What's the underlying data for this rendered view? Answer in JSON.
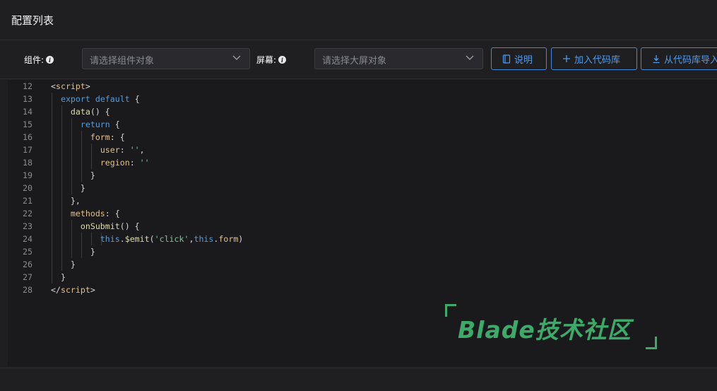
{
  "header": {
    "title": "配置列表"
  },
  "toolbar": {
    "component_label": "组件:",
    "component_placeholder": "请选择组件对象",
    "screen_label": "屏幕:",
    "screen_placeholder": "请选择大屏对象",
    "btn_desc": "说明",
    "btn_add": "加入代码库",
    "btn_import": "从代码库导入"
  },
  "editor": {
    "line_numbers": [
      "12",
      "13",
      "14",
      "15",
      "16",
      "17",
      "18",
      "19",
      "20",
      "21",
      "22",
      "23",
      "24",
      "25",
      "26",
      "27",
      "28"
    ]
  },
  "watermark": {
    "text": "Blade技术社区"
  },
  "colors": {
    "accent": "#3f88dc",
    "watermark": "#3daa69",
    "background": "#1f1f22"
  }
}
